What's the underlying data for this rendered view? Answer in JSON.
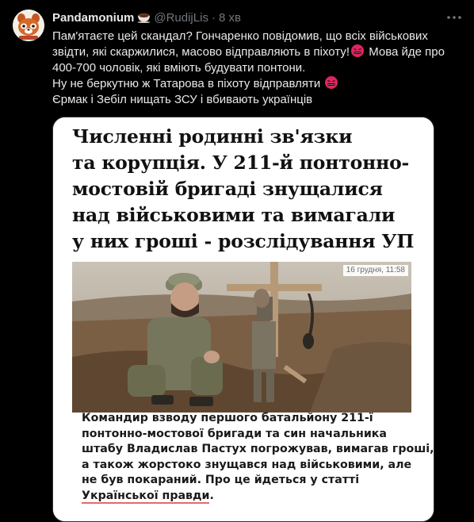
{
  "tweet": {
    "display_name": "Pandamonium",
    "name_emoji": "cup-emoji",
    "handle": "@RudijLis",
    "separator": "·",
    "time": "8 хв",
    "text_lines": {
      "l1": "Пам'ятаєте цей скандал?  Гончаренко повідомив, що всіх військових",
      "l2a": "звідти, які скаржилися, масово відправляють в піхоту!",
      "l2b": "Мова йде про",
      "l3": "400-700 чоловік, які вміють будувати понтони.",
      "l4": "Ну не беркутню ж Татарова в піхоту відправляти",
      "l5": "Єрмак і Зебіл нищать ЗСУ і вбивають українців"
    },
    "emoji_inline": "angry-symbols-face-emoji"
  },
  "media": {
    "headline": {
      "l1": "Численні родинні зв'язки",
      "l2": "та корупція. У 211-й понтонно-",
      "l3": "мостовій бригаді знущалися",
      "l4": "над військовими та вимагали",
      "l5": "у них гроші - розслідування УП"
    },
    "dateline": "16 грудня, 11:58",
    "caption": {
      "l1": "Командир взводу першого батальйону 211-ї",
      "l2": "понтонно-мостової бригади та син начальника",
      "l3": "штабу Владислав Пастух погрожував, вимагав гроші,",
      "l4": "а також жорстоко знущався над військовими, але",
      "l5": "не був покараний. Про це йдеться у статті",
      "l6_link": "Української правди",
      "l6_end": "."
    }
  },
  "colors": {
    "background": "#000000",
    "text_primary": "#e7e9ea",
    "text_secondary": "#71767b",
    "border": "#2f3336",
    "emoji_red": "#e0245e",
    "link_underline": "#e36a6a"
  }
}
